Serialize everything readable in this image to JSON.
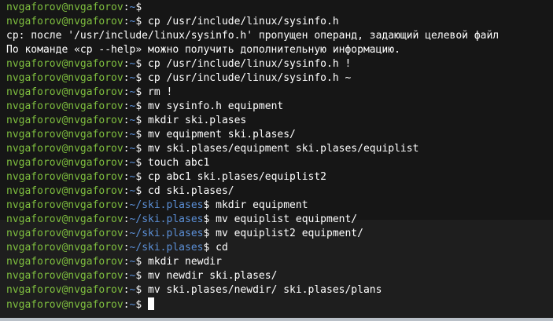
{
  "terminal": {
    "colors": {
      "background": "#1e1e1e",
      "user": "#7fbf3f",
      "path": "#5b8fd6",
      "text": "#ffffff"
    },
    "lines": [
      {
        "type": "prompt",
        "user": "nvgaforov@nvgaforov",
        "path": "~",
        "cmd": ""
      },
      {
        "type": "prompt",
        "user": "nvgaforov@nvgaforov",
        "path": "~",
        "cmd": "cp /usr/include/linux/sysinfo.h"
      },
      {
        "type": "output",
        "text": "cp: после '/usr/include/linux/sysinfo.h' пропущен операнд, задающий целевой файл"
      },
      {
        "type": "output",
        "text": "По команде «cp --help» можно получить дополнительную информацию."
      },
      {
        "type": "prompt",
        "user": "nvgaforov@nvgaforov",
        "path": "~",
        "cmd": "cp /usr/include/linux/sysinfo.h !"
      },
      {
        "type": "prompt",
        "user": "nvgaforov@nvgaforov",
        "path": "~",
        "cmd": "cp /usr/include/linux/sysinfo.h ~"
      },
      {
        "type": "prompt",
        "user": "nvgaforov@nvgaforov",
        "path": "~",
        "cmd": "rm !"
      },
      {
        "type": "prompt",
        "user": "nvgaforov@nvgaforov",
        "path": "~",
        "cmd": "mv sysinfo.h equipment"
      },
      {
        "type": "prompt",
        "user": "nvgaforov@nvgaforov",
        "path": "~",
        "cmd": "mkdir ski.plases"
      },
      {
        "type": "prompt",
        "user": "nvgaforov@nvgaforov",
        "path": "~",
        "cmd": "mv equipment ski.plases/"
      },
      {
        "type": "prompt",
        "user": "nvgaforov@nvgaforov",
        "path": "~",
        "cmd": "mv ski.plases/equipment ski.plases/equiplist"
      },
      {
        "type": "prompt",
        "user": "nvgaforov@nvgaforov",
        "path": "~",
        "cmd": "touch abc1"
      },
      {
        "type": "prompt",
        "user": "nvgaforov@nvgaforov",
        "path": "~",
        "cmd": "cp abc1 ski.plases/equiplist2"
      },
      {
        "type": "prompt",
        "user": "nvgaforov@nvgaforov",
        "path": "~",
        "cmd": "cd ski.plases/"
      },
      {
        "type": "prompt",
        "user": "nvgaforov@nvgaforov",
        "path": "~/ski.plases",
        "cmd": "mkdir equipment"
      },
      {
        "type": "prompt",
        "user": "nvgaforov@nvgaforov",
        "path": "~/ski.plases",
        "cmd": "mv equiplist equipment/"
      },
      {
        "type": "prompt",
        "user": "nvgaforov@nvgaforov",
        "path": "~/ski.plases",
        "cmd": "mv equiplist2 equipment/"
      },
      {
        "type": "prompt",
        "user": "nvgaforov@nvgaforov",
        "path": "~/ski.plases",
        "cmd": "cd"
      },
      {
        "type": "prompt",
        "user": "nvgaforov@nvgaforov",
        "path": "~",
        "cmd": "mkdir newdir"
      },
      {
        "type": "prompt",
        "user": "nvgaforov@nvgaforov",
        "path": "~",
        "cmd": "mv newdir ski.plases/"
      },
      {
        "type": "prompt",
        "user": "nvgaforov@nvgaforov",
        "path": "~",
        "cmd": "mv ski.plases/newdir/ ski.plases/plans"
      },
      {
        "type": "prompt",
        "user": "nvgaforov@nvgaforov",
        "path": "~",
        "cmd": "",
        "cursor": true
      }
    ]
  },
  "background_peek": {
    "glyph": "3"
  }
}
